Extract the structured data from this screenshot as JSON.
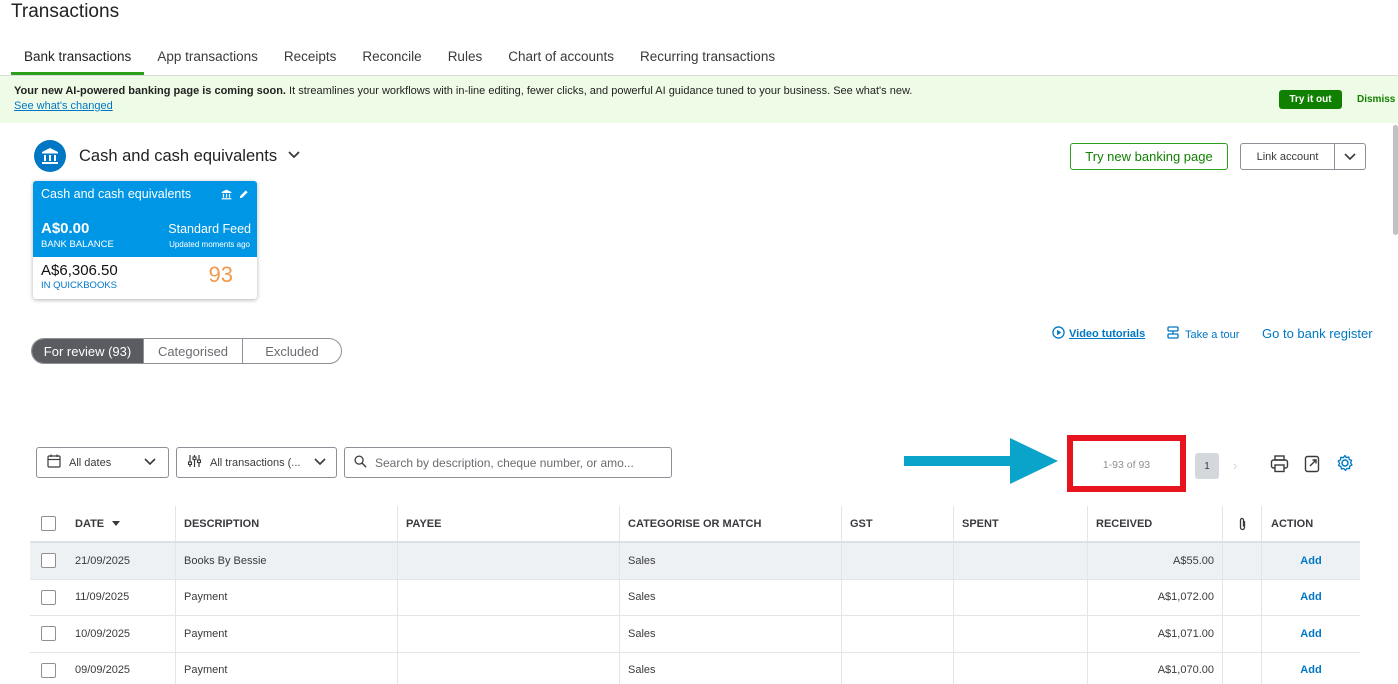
{
  "page": {
    "title": "Transactions"
  },
  "tabs": [
    {
      "label": "Bank transactions",
      "active": true
    },
    {
      "label": "App transactions",
      "active": false
    },
    {
      "label": "Receipts",
      "active": false
    },
    {
      "label": "Reconcile",
      "active": false
    },
    {
      "label": "Rules",
      "active": false
    },
    {
      "label": "Chart of accounts",
      "active": false
    },
    {
      "label": "Recurring transactions",
      "active": false
    }
  ],
  "banner": {
    "bold": "Your new AI-powered banking page is coming soon.",
    "text": " It streamlines your workflows with in-line editing, fewer clicks, and powerful AI guidance tuned to your business. See what's new.",
    "link": "See what's changed",
    "try_label": "Try it out",
    "dismiss_label": "Dismiss"
  },
  "account": {
    "name": "Cash and cash equivalents",
    "new_banking_btn": "Try new banking page",
    "link_account_btn": "Link account"
  },
  "card": {
    "title": "Cash and cash equivalents",
    "bank_balance": "A$0.00",
    "bank_balance_label": "BANK BALANCE",
    "feed": "Standard Feed",
    "updated": "Updated moments ago",
    "qb_balance": "A$6,306.50",
    "qb_label": "IN QUICKBOOKS",
    "count": "93"
  },
  "segments": [
    {
      "label": "For review (93)",
      "active": true
    },
    {
      "label": "Categorised",
      "active": false
    },
    {
      "label": "Excluded",
      "active": false
    }
  ],
  "help": {
    "video": "Video tutorials",
    "tour": "Take a tour",
    "register": "Go to bank register"
  },
  "filters": {
    "dates": "All dates",
    "transactions": "All transactions (...",
    "search_placeholder": "Search by description, cheque number, or amo..."
  },
  "pagination": {
    "range": "1-93 of 93",
    "page": "1"
  },
  "table": {
    "headers": {
      "date": "DATE",
      "description": "DESCRIPTION",
      "payee": "PAYEE",
      "categorise": "CATEGORISE OR MATCH",
      "gst": "GST",
      "spent": "SPENT",
      "received": "RECEIVED",
      "action": "ACTION"
    },
    "rows": [
      {
        "date": "21/09/2025",
        "description": "Books By Bessie",
        "payee": "",
        "category": "Sales",
        "gst": "",
        "spent": "",
        "received": "A$55.00",
        "action": "Add"
      },
      {
        "date": "11/09/2025",
        "description": "Payment",
        "payee": "",
        "category": "Sales",
        "gst": "",
        "spent": "",
        "received": "A$1,072.00",
        "action": "Add"
      },
      {
        "date": "10/09/2025",
        "description": "Payment",
        "payee": "",
        "category": "Sales",
        "gst": "",
        "spent": "",
        "received": "A$1,071.00",
        "action": "Add"
      },
      {
        "date": "09/09/2025",
        "description": "Payment",
        "payee": "",
        "category": "Sales",
        "gst": "",
        "spent": "",
        "received": "A$1,070.00",
        "action": "Add"
      }
    ]
  },
  "colors": {
    "brand_green": "#2ca01c",
    "link_blue": "#0077c5",
    "card_blue": "#0096e6",
    "annotation_arrow": "#0aa3c9",
    "annotation_box": "#e8141d",
    "count_orange": "#f2994a"
  }
}
